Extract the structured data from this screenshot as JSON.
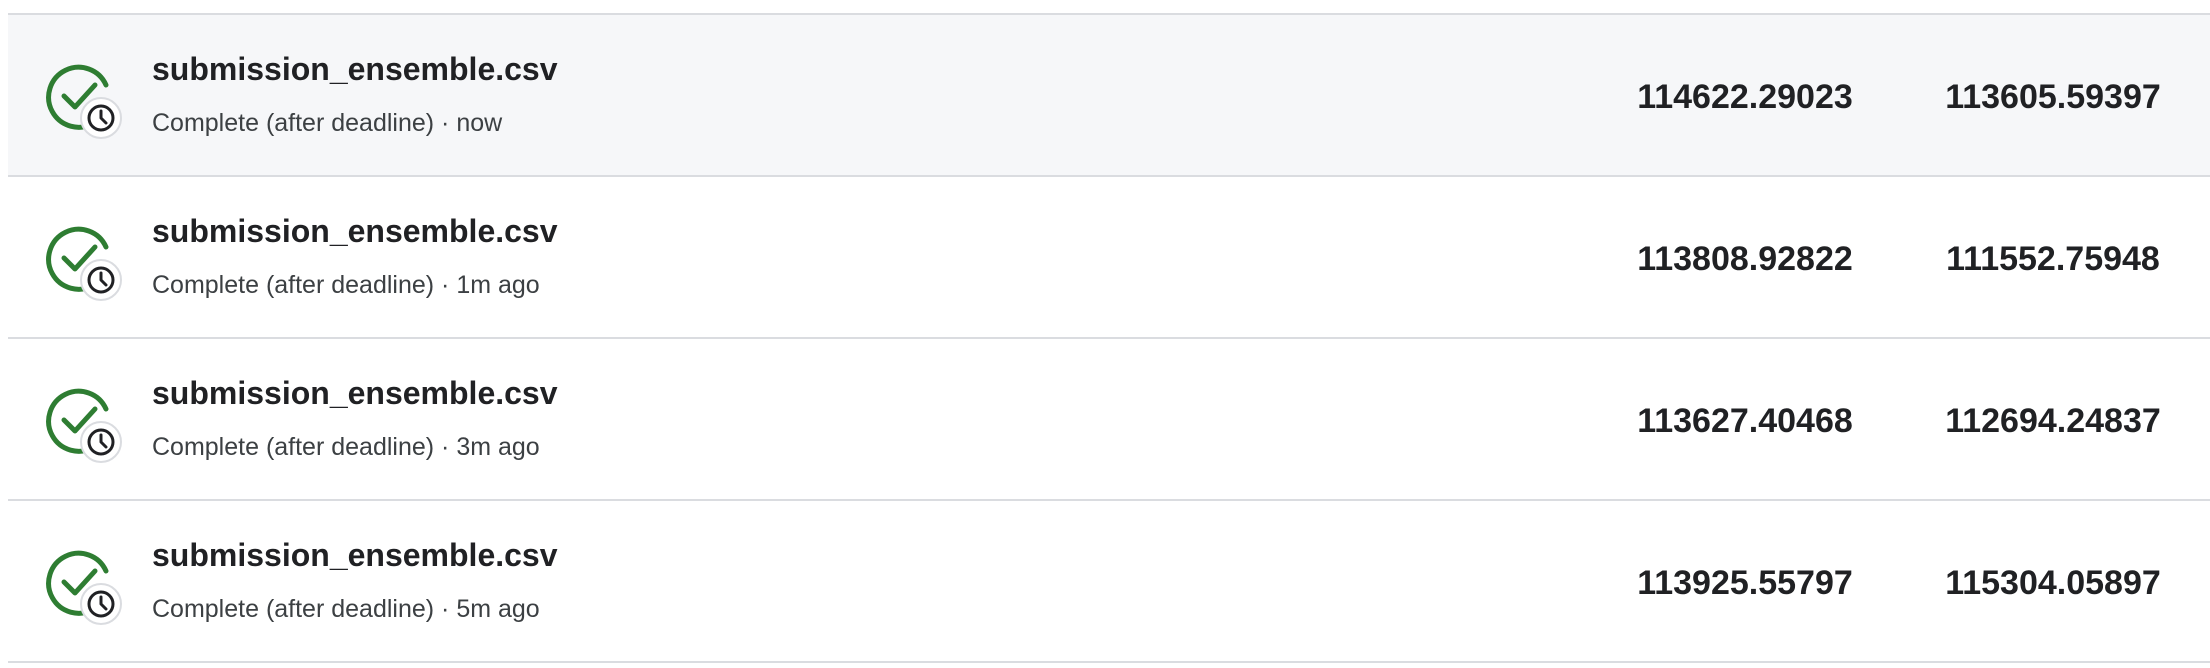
{
  "colors": {
    "success_green": "#2e7d32",
    "clock_stroke": "#202124",
    "row_highlight": "#f6f7f9",
    "divider": "#dadce0"
  },
  "icons": {
    "status": "check-circle-with-clock-icon"
  },
  "submissions": [
    {
      "file_name": "submission_ensemble.csv",
      "status": "Complete (after deadline)",
      "time": "now",
      "public_score": "114622.29023",
      "private_score": "113605.59397",
      "highlighted": true
    },
    {
      "file_name": "submission_ensemble.csv",
      "status": "Complete (after deadline)",
      "time": "1m ago",
      "public_score": "113808.92822",
      "private_score": "111552.75948",
      "highlighted": false
    },
    {
      "file_name": "submission_ensemble.csv",
      "status": "Complete (after deadline)",
      "time": "3m ago",
      "public_score": "113627.40468",
      "private_score": "112694.24837",
      "highlighted": false
    },
    {
      "file_name": "submission_ensemble.csv",
      "status": "Complete (after deadline)",
      "time": "5m ago",
      "public_score": "113925.55797",
      "private_score": "115304.05897",
      "highlighted": false
    }
  ]
}
